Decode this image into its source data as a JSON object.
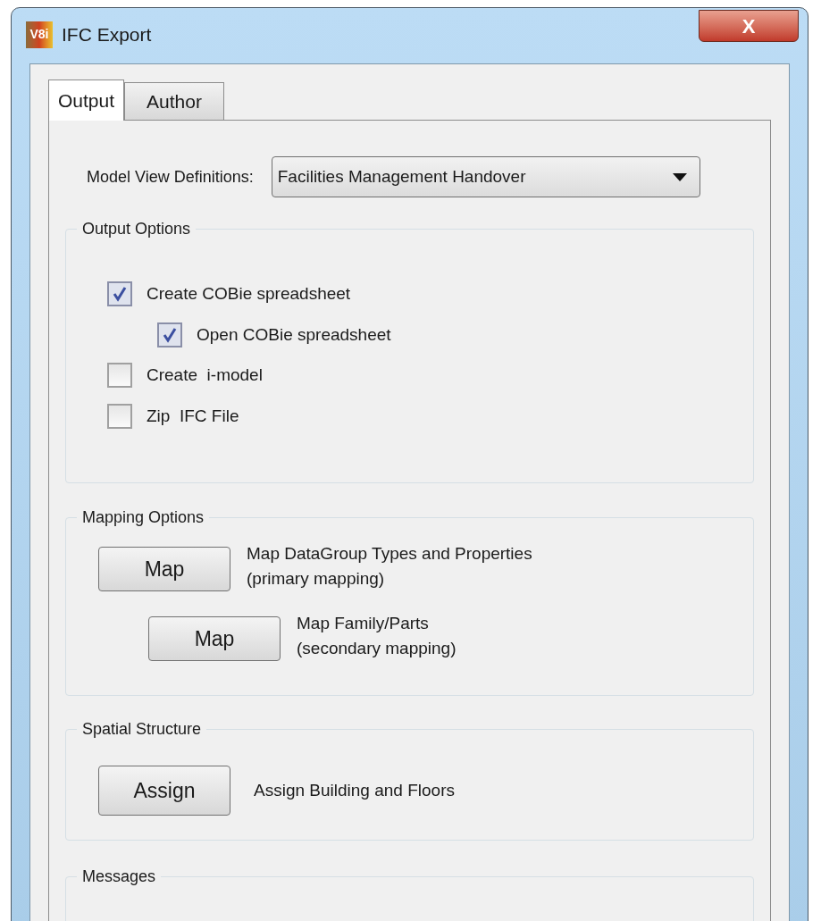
{
  "window": {
    "title": "IFC Export",
    "icon_text": "V8i",
    "close": "X"
  },
  "tabs": [
    {
      "label": "Output",
      "selected": true
    },
    {
      "label": "Author",
      "selected": false
    }
  ],
  "model_view": {
    "label": "Model View Definitions:",
    "value": "Facilities Management Handover"
  },
  "output_options": {
    "title": "Output Options",
    "items": [
      {
        "label": "Create COBie spreadsheet",
        "checked": true,
        "children": [
          {
            "label": "Open COBie spreadsheet",
            "checked": true
          }
        ]
      },
      {
        "label": "Create  i-model",
        "checked": false
      },
      {
        "label": "Zip  IFC File",
        "checked": false
      }
    ]
  },
  "mapping_options": {
    "title": "Mapping Options",
    "rows": [
      {
        "button": "Map",
        "lines": [
          "Map DataGroup Types and Properties",
          "(primary mapping)"
        ]
      },
      {
        "button": "Map",
        "lines": [
          "Map Family/Parts",
          "(secondary mapping)"
        ]
      }
    ]
  },
  "spatial_structure": {
    "title": "Spatial Structure",
    "button": "Assign",
    "description": "Assign Building and Floors"
  },
  "messages": {
    "title": "Messages"
  }
}
